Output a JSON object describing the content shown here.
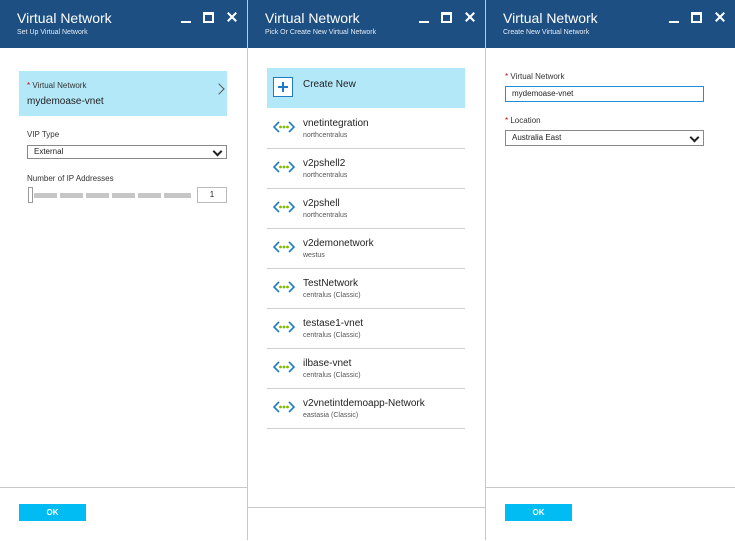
{
  "blade1": {
    "title": "Virtual Network",
    "subtitle": "Set Up Virtual Network",
    "vnet_label_required": "*",
    "vnet_label": "Virtual Network",
    "vnet_value": "mydemoase-vnet",
    "vip_label": "VIP Type",
    "vip_value": "External",
    "ip_label": "Number of IP Addresses",
    "ip_value": "1",
    "ip_slider_fraction": 0,
    "ok_label": "OK"
  },
  "blade2": {
    "title": "Virtual Network",
    "subtitle": "Pick Or Create New Virtual Network",
    "create_label": "Create New",
    "items": [
      {
        "name": "vnetintegration",
        "location": "northcentralus"
      },
      {
        "name": "v2pshell2",
        "location": "northcentralus"
      },
      {
        "name": "v2pshell",
        "location": "northcentralus"
      },
      {
        "name": "v2demonetwork",
        "location": "westus"
      },
      {
        "name": "TestNetwork",
        "location": "centralus (Classic)"
      },
      {
        "name": "testase1-vnet",
        "location": "centralus (Classic)"
      },
      {
        "name": "ilbase-vnet",
        "location": "centralus (Classic)"
      },
      {
        "name": "v2vnetintdemoapp-Network",
        "location": "eastasia (Classic)"
      }
    ]
  },
  "blade3": {
    "title": "Virtual Network",
    "subtitle": "Create New Virtual Network",
    "vnet_label_required": "*",
    "vnet_label": "Virtual Network",
    "vnet_value": "mydemoase-vnet",
    "location_label_required": "*",
    "location_label": "Location",
    "location_value": "Australia East",
    "ok_label": "OK"
  },
  "icons": {
    "minimize": "minimize-icon",
    "maximize": "maximize-icon",
    "close": "close-icon",
    "vnet": "virtual-network-icon",
    "plus": "plus-icon"
  },
  "colors": {
    "header": "#1d4f83",
    "selected": "#b3e8f8",
    "ok_button": "#00bcf2",
    "vnet_icon_green": "#7fba00",
    "vnet_icon_blue": "#1e7bc4"
  }
}
